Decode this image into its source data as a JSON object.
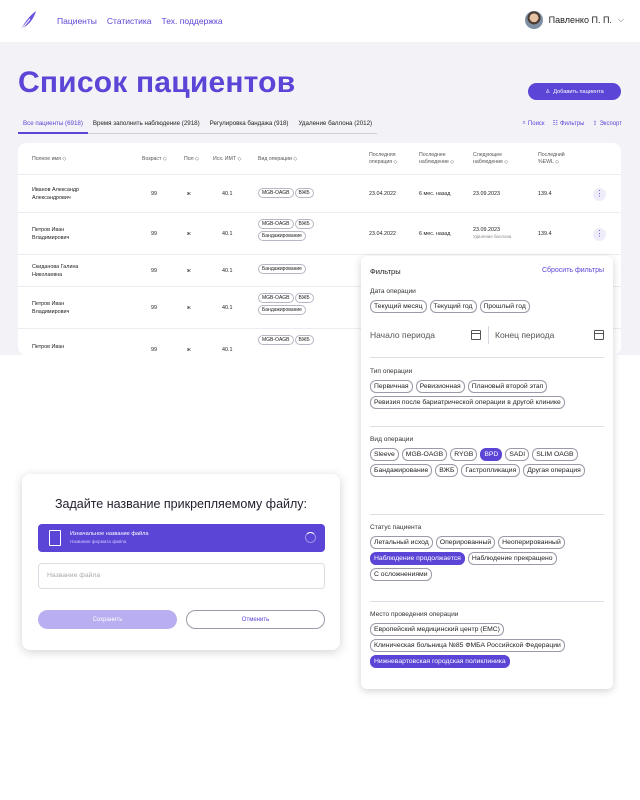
{
  "nav": {
    "links": [
      "Пациенты",
      "Статистика",
      "Тех. поддержка"
    ],
    "user_name": "Павленко П. П."
  },
  "page": {
    "title": "Список пациентов",
    "add_button": "Добавить пациента"
  },
  "tabs": [
    "Все пациенты (6918)",
    "Время заполнить наблюдение (2918)",
    "Регулировка бандажа (918)",
    "Удаление баллона (2012)"
  ],
  "tools": {
    "search": "Поиск",
    "filters": "Фильтры",
    "export": "Экспорт"
  },
  "table": {
    "headers": {
      "name": "Полное имя",
      "age": "Возраст",
      "sex": "Пол",
      "bmi": "Исх. ИМТ",
      "op_type": "Вид операции",
      "last_op_1": "Последняя",
      "last_op_2": "операция",
      "last_obs_1": "Последнее",
      "last_obs_2": "наблюдение",
      "next_obs_1": "Следующее",
      "next_obs_2": "наблюдение",
      "ewl_1": "Последний",
      "ewl_2": "%EWL"
    },
    "rows": [
      {
        "name1": "Иванов Александр",
        "name2": "Александрович",
        "age": "99",
        "sex": "ж",
        "bmi": "40.1",
        "chips": [
          "MGB-OAGB",
          "ВЖБ"
        ],
        "last_op": "23.04.2022",
        "last_obs": "6 мес. назад",
        "next_obs": "23.09.2023",
        "next_sub": "",
        "ewl": "139.4"
      },
      {
        "name1": "Петров Иван",
        "name2": "Владимирович",
        "age": "99",
        "sex": "ж",
        "bmi": "40.1",
        "chips": [
          "MGB-OAGB",
          "ВЖБ",
          "Бандажирование"
        ],
        "last_op": "23.04.2022",
        "last_obs": "6 мес. назад",
        "next_obs": "23.09.2023",
        "next_sub": "Удаление баллона",
        "ewl": "139.4"
      },
      {
        "name1": "Скиданова Галина",
        "name2": "Николаевна",
        "age": "99",
        "sex": "ж",
        "bmi": "40.1",
        "chips": [
          "Бандажирование"
        ]
      },
      {
        "name1": "Петров Иван",
        "name2": "Владимирович",
        "age": "99",
        "sex": "ж",
        "bmi": "40.1",
        "chips": [
          "MGB-OAGB",
          "ВЖБ",
          "Бандажирование"
        ]
      },
      {
        "name1": "Петров Иван",
        "name2": "",
        "age": "99",
        "sex": "ж",
        "bmi": "40.1",
        "chips": [
          "MGB-OAGB",
          "ВЖБ"
        ]
      }
    ]
  },
  "filters": {
    "title": "Фильтры",
    "reset": "Сбросить фильтры",
    "op_date": {
      "label": "Дата операции",
      "options": [
        "Текущий месяц",
        "Текущий год",
        "Прошлый год"
      ],
      "start_placeholder": "Начало периода",
      "end_placeholder": "Конец периода"
    },
    "op_kind": {
      "label": "Тип операции",
      "options": [
        "Первичная",
        "Ревизионная",
        "Плановый второй этап",
        "Ревизия после бариатрической операции в другой клинике"
      ]
    },
    "op_view": {
      "label": "Вид операции",
      "options": [
        "Sleeve",
        "MGB-OAGB",
        "RYGB",
        "BPD",
        "SADI",
        "SLIM OAGB",
        "Бандажирование",
        "ВЖБ",
        "Гастропликация",
        "Другая операция"
      ],
      "selected": [
        "BPD"
      ]
    },
    "status": {
      "label": "Статус пациента",
      "options": [
        "Летальный исход",
        "Оперированный",
        "Неоперированный",
        "Наблюдение продолжается",
        "Наблюдение прекращено",
        "С осложнениями"
      ],
      "selected": [
        "Наблюдение продолжается"
      ]
    },
    "place": {
      "label": "Место проведения операции",
      "options": [
        "Европейский медицинский центр (EMC)",
        "Клиническая больница №85 ФМБА Российской Федерации",
        "Нижневартовская городская поликлиника"
      ],
      "selected": [
        "Нижневартовская городская поликлиника"
      ]
    }
  },
  "dialog": {
    "title": "Задайте название прикрепляемому файлу:",
    "file_name": "Изначальное название файла",
    "file_format": "Название формата файла",
    "input_placeholder": "Название файла",
    "save": "Сохранить",
    "cancel": "Отменить"
  },
  "colors": {
    "accent": "#5b45d6",
    "accent_light": "#b8aef0",
    "page_bg": "#f3f3f7"
  }
}
